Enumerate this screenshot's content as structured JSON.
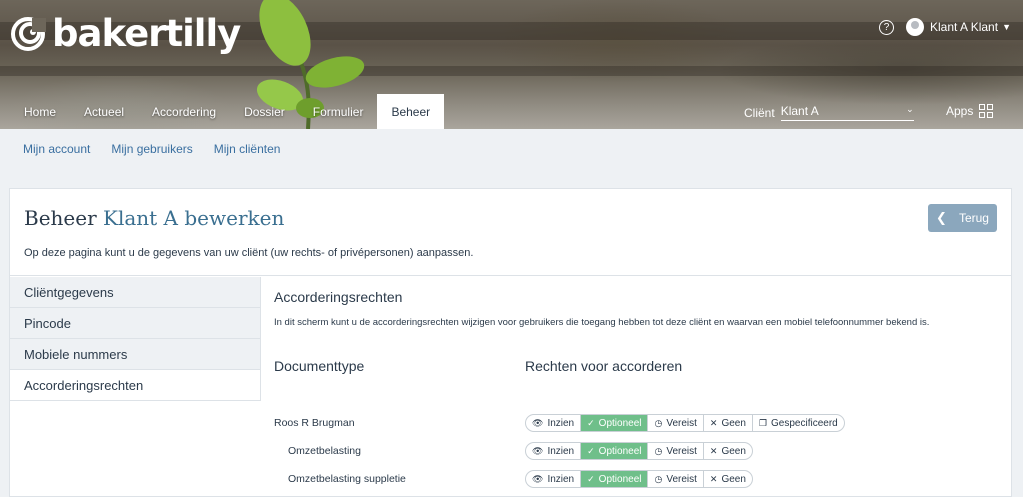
{
  "brand": {
    "name": "bakertilly"
  },
  "user": {
    "help": "?",
    "name": "Klant A Klant"
  },
  "nav": {
    "items": [
      {
        "label": "Home"
      },
      {
        "label": "Actueel"
      },
      {
        "label": "Accordering"
      },
      {
        "label": "Dossier"
      },
      {
        "label": "Formulier"
      },
      {
        "label": "Beheer"
      }
    ],
    "active": "Beheer"
  },
  "client_select": {
    "label": "Cliënt",
    "value": "Klant A"
  },
  "apps": {
    "label": "Apps"
  },
  "subnav": {
    "items": [
      {
        "label": "Mijn account"
      },
      {
        "label": "Mijn gebruikers"
      },
      {
        "label": "Mijn cliënten"
      }
    ]
  },
  "page": {
    "title_prefix": "Beheer",
    "title_accent": "Klant A bewerken",
    "description": "Op deze pagina kunt u de gegevens van uw cliënt (uw rechts- of privépersonen) aanpassen.",
    "back_label": "Terug"
  },
  "sidebar": {
    "items": [
      {
        "label": "Cliëntgegevens"
      },
      {
        "label": "Pincode"
      },
      {
        "label": "Mobiele nummers"
      },
      {
        "label": "Accorderingsrechten"
      }
    ],
    "active": "Accorderingsrechten"
  },
  "section": {
    "title": "Accorderingsrechten",
    "description": "In dit scherm kunt u de accorderingsrechten wijzigen voor gebruikers die toegang hebben tot deze cliënt en waarvan een mobiel telefoonnummer bekend is.",
    "col_documenttype": "Documenttype",
    "col_rights": "Rechten voor accorderen"
  },
  "options": {
    "inzien": "Inzien",
    "optioneel": "Optioneel",
    "vereist": "Vereist",
    "geen": "Geen",
    "gespecificeerd": "Gespecificeerd"
  },
  "rows": [
    {
      "label": "Roos R Brugman",
      "selected": "Optioneel",
      "show_gespecificeerd": true
    },
    {
      "label": "Omzetbelasting",
      "selected": "Optioneel",
      "show_gespecificeerd": false
    },
    {
      "label": "Omzetbelasting suppletie",
      "selected": "Optioneel",
      "show_gespecificeerd": false
    }
  ],
  "colors": {
    "accent": "#3a6f90",
    "selected": "#6fbf8a",
    "back_button": "#8ba7bd",
    "link": "#3a6fa0"
  }
}
